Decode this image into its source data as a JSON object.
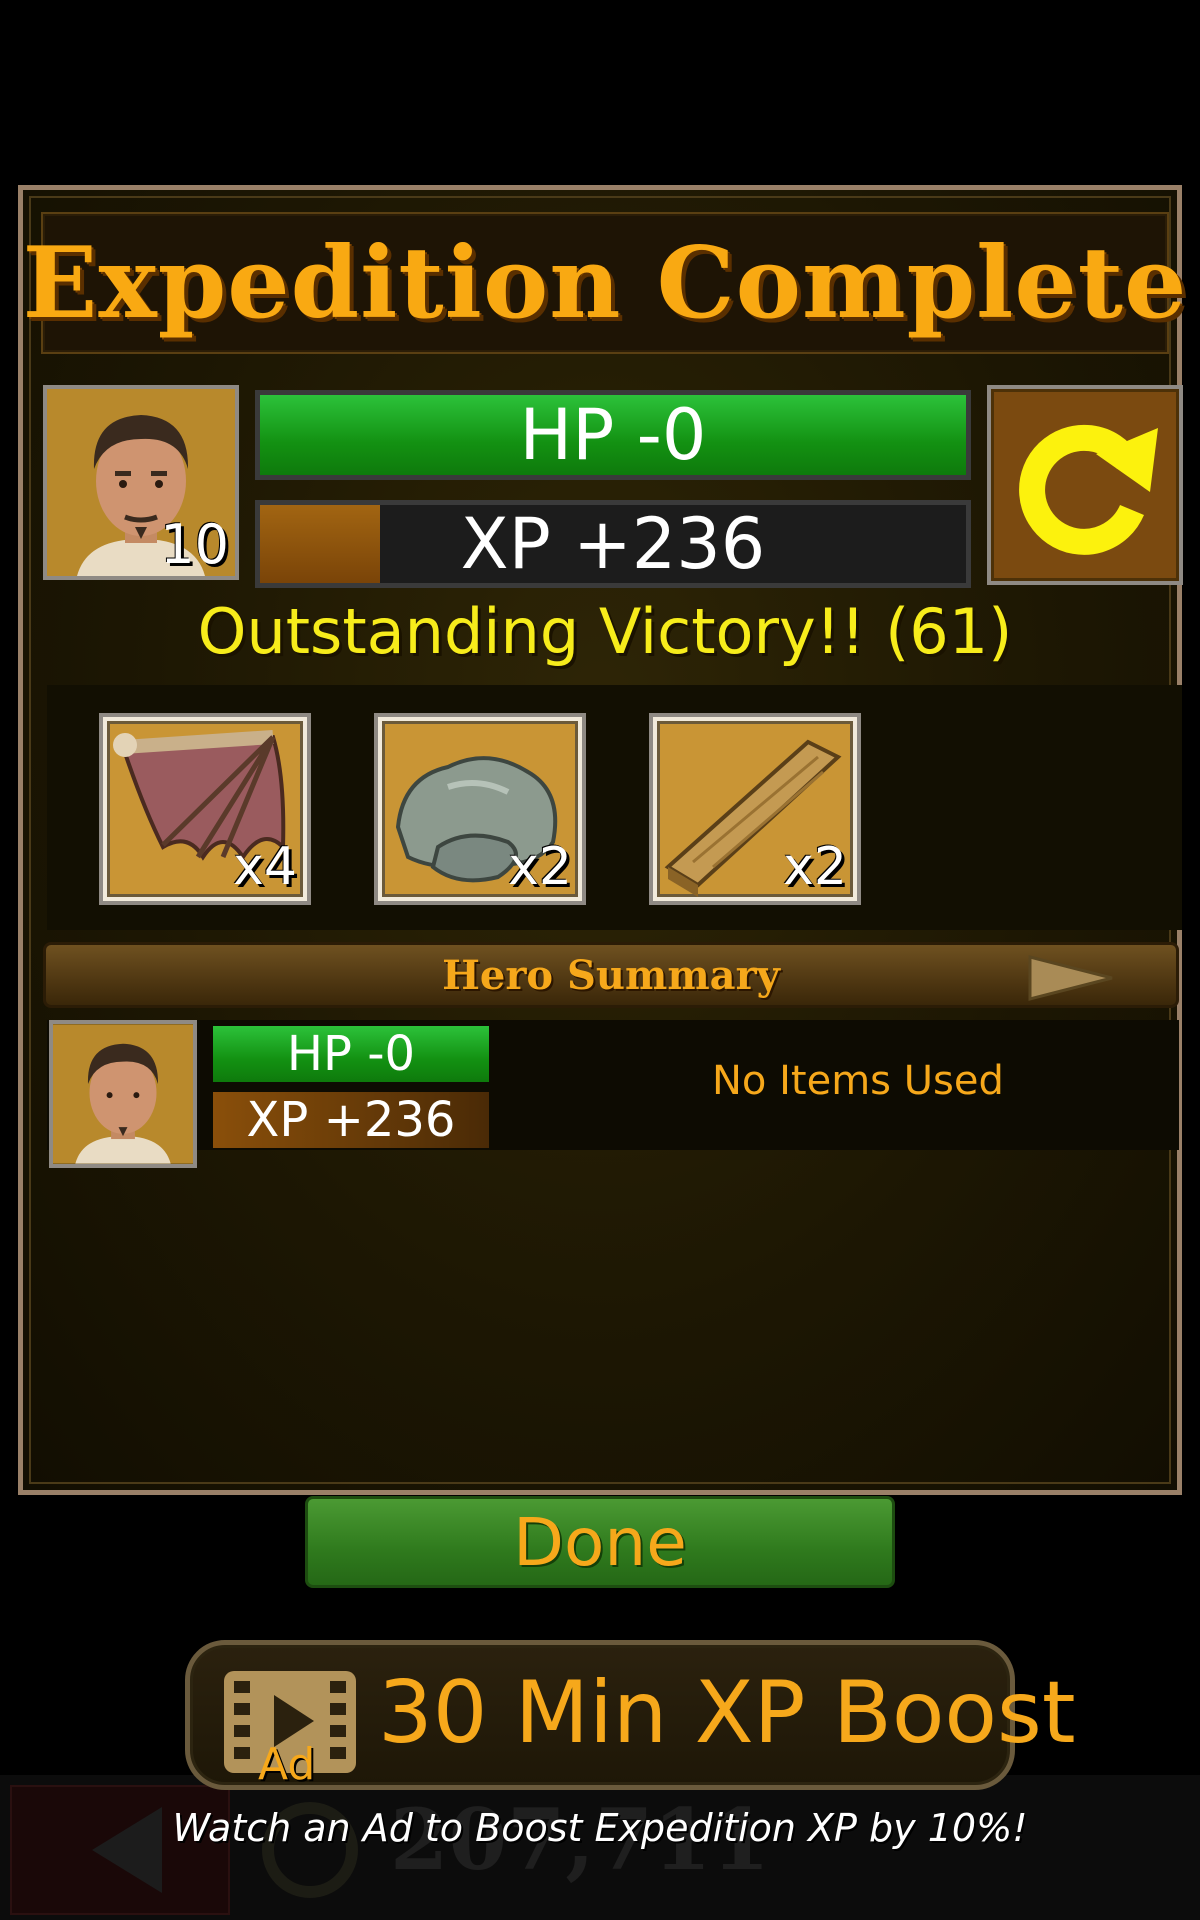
{
  "header": {
    "title": "Expedition Complete"
  },
  "hero": {
    "level": "10",
    "hp_text": "HP -0",
    "xp_text": "XP +236",
    "xp_progress": 0.17
  },
  "result": {
    "victory_text": "Outstanding Victory!! (61)"
  },
  "loot": [
    {
      "icon": "bat-wing-icon",
      "count": "x4"
    },
    {
      "icon": "stone-icon",
      "count": "x2"
    },
    {
      "icon": "wood-plank-icon",
      "count": "x2"
    }
  ],
  "summary": {
    "title": "Hero Summary",
    "hero_hp": "HP -0",
    "hero_xp": "XP +236",
    "items_used": "No Items Used"
  },
  "buttons": {
    "done": "Done"
  },
  "ad": {
    "label": "30 Min XP Boost",
    "badge": "Ad",
    "caption": "Watch an Ad to Boost Expedition XP by 10%!"
  },
  "hud": {
    "coins": "207,711"
  },
  "colors": {
    "accent": "#f6a81b",
    "hp_green": "#139112",
    "victory_yellow": "#f7ec1b"
  }
}
